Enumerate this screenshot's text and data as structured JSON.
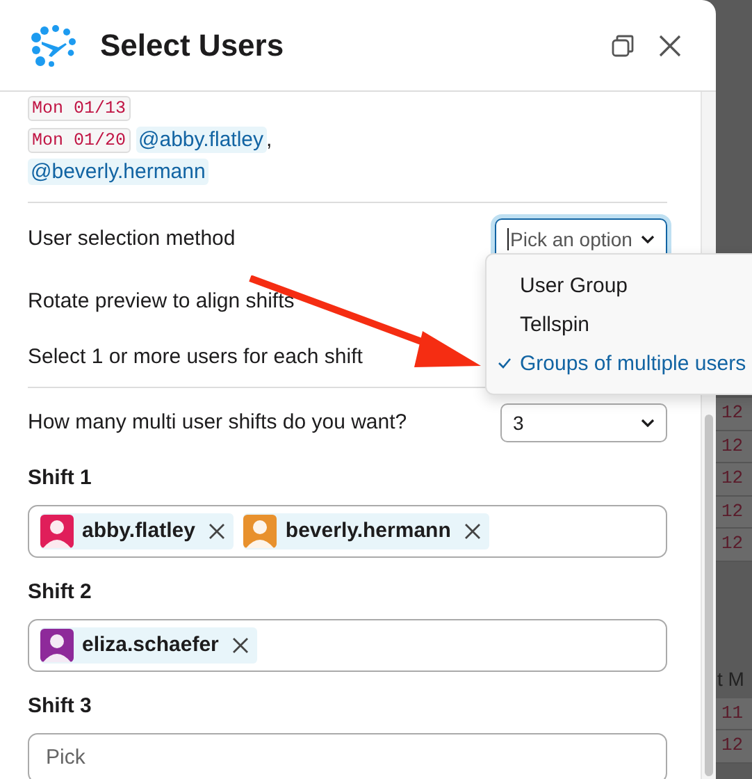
{
  "window": {
    "title": "Select Users"
  },
  "preview": [
    [
      {
        "kind": "date",
        "text": "Mon 01/13"
      }
    ],
    [
      {
        "kind": "date",
        "text": "Mon 01/20"
      },
      {
        "kind": "mention",
        "text": "@abby.flatley"
      },
      {
        "kind": "punct",
        "text": ","
      }
    ],
    [
      {
        "kind": "mention",
        "text": "@beverly.hermann"
      }
    ]
  ],
  "selection_method": {
    "label": "User selection method",
    "placeholder": "Pick an option",
    "focused": true
  },
  "options_menu": [
    {
      "label": "User Group",
      "selected": false
    },
    {
      "label": "Tellspin",
      "selected": false
    },
    {
      "label": "Groups of multiple users",
      "selected": true
    }
  ],
  "notes": [
    "Rotate preview to align shifts",
    "Select 1 or more users for each shift"
  ],
  "shift_count": {
    "label": "How many multi user shifts do you want?",
    "value": "3"
  },
  "shifts": [
    {
      "label": "Shift 1",
      "users": [
        {
          "name": "abby.flatley",
          "color": "#e01e5a"
        },
        {
          "name": "beverly.hermann",
          "color": "#e8912d"
        }
      ]
    },
    {
      "label": "Shift 2",
      "users": [
        {
          "name": "eliza.schaefer",
          "color": "#8e2a9a"
        }
      ]
    },
    {
      "label": "Shift 3",
      "placeholder": "Pick"
    }
  ],
  "background": [
    {
      "kind": "date",
      "text": "12"
    },
    {
      "kind": "date",
      "text": "12"
    },
    {
      "kind": "date",
      "text": "12"
    },
    {
      "kind": "date",
      "text": "12"
    },
    {
      "kind": "date",
      "text": "12"
    },
    {
      "kind": "gap"
    },
    {
      "kind": "text",
      "text": "t M"
    },
    {
      "kind": "date",
      "text": "11"
    },
    {
      "kind": "date",
      "text": "12"
    }
  ]
}
